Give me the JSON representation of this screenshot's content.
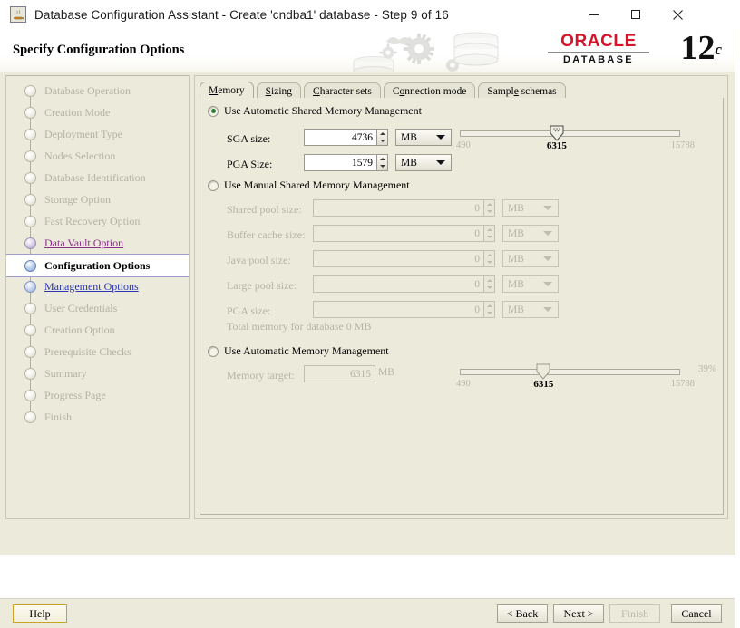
{
  "window": {
    "title": "Database Configuration Assistant - Create 'cndba1' database - Step 9 of 16",
    "icon": "java-cup-icon",
    "minimize_label": "—",
    "maximize_label": "□",
    "close_label": "✕"
  },
  "banner": {
    "heading": "Specify Configuration Options",
    "brand_word": "ORACLE",
    "brand_reg": "®",
    "brand_product": "DATABASE",
    "version_number": "12",
    "version_suffix": "c"
  },
  "sidebar": {
    "steps": [
      {
        "label": "Database Operation",
        "state": "done"
      },
      {
        "label": "Creation Mode",
        "state": "done"
      },
      {
        "label": "Deployment Type",
        "state": "done"
      },
      {
        "label": "Nodes Selection",
        "state": "done"
      },
      {
        "label": "Database Identification",
        "state": "done"
      },
      {
        "label": "Storage Option",
        "state": "done"
      },
      {
        "label": "Fast Recovery Option",
        "state": "done"
      },
      {
        "label": "Data Vault Option",
        "state": "visited"
      },
      {
        "label": "Configuration Options",
        "state": "active"
      },
      {
        "label": "Management Options",
        "state": "link"
      },
      {
        "label": "User Credentials",
        "state": "done"
      },
      {
        "label": "Creation Option",
        "state": "done"
      },
      {
        "label": "Prerequisite Checks",
        "state": "done"
      },
      {
        "label": "Summary",
        "state": "done"
      },
      {
        "label": "Progress Page",
        "state": "done"
      },
      {
        "label": "Finish",
        "state": "done"
      }
    ]
  },
  "tabs": [
    {
      "label": "Memory",
      "mnemonic": "M",
      "selected": true
    },
    {
      "label": "Sizing",
      "mnemonic": "S",
      "selected": false
    },
    {
      "label": "Character sets",
      "mnemonic": "C",
      "selected": false
    },
    {
      "label": "Connection mode",
      "mnemonic": "o",
      "selected": false
    },
    {
      "label": "Sample schemas",
      "mnemonic": "e",
      "selected": false
    }
  ],
  "memory_tab": {
    "automatic_shared": {
      "radio_label": "Use Automatic Shared Memory Management",
      "selected": true,
      "fields": [
        {
          "label": "SGA size:",
          "value": "4736",
          "unit": "MB"
        },
        {
          "label": "PGA Size:",
          "value": "1579",
          "unit": "MB"
        }
      ],
      "slider": {
        "min_label": "490",
        "value_label": "6315",
        "max_label": "15788",
        "position_pct": 44
      }
    },
    "manual_shared": {
      "radio_label": "Use Manual Shared Memory Management",
      "selected": false,
      "fields": [
        {
          "label": "Shared pool size:",
          "value": "0",
          "unit": "MB"
        },
        {
          "label": "Buffer cache size:",
          "value": "0",
          "unit": "MB"
        },
        {
          "label": "Java pool size:",
          "value": "0",
          "unit": "MB"
        },
        {
          "label": "Large pool size:",
          "value": "0",
          "unit": "MB"
        },
        {
          "label": "PGA size:",
          "value": "0",
          "unit": "MB"
        }
      ],
      "total_text": "Total memory for database 0 MB"
    },
    "automatic_memory": {
      "radio_label": "Use Automatic Memory Management",
      "selected": false,
      "target_label": "Memory target:",
      "target_value": "6315",
      "target_unit": "MB",
      "slider": {
        "min_label": "490",
        "value_label": "6315",
        "max_label": "15788",
        "percent_label": "39%",
        "position_pct": 38
      }
    }
  },
  "footer": {
    "help": "Help",
    "back": "< Back",
    "next": "Next >",
    "finish": "Finish",
    "cancel": "Cancel"
  },
  "colors": {
    "window_bg": "#ECEADB",
    "oracle_red": "#D5132B",
    "link_blue": "#2B35B8",
    "visited_purple": "#8A2F8A",
    "radio_green": "#2F7D32"
  }
}
